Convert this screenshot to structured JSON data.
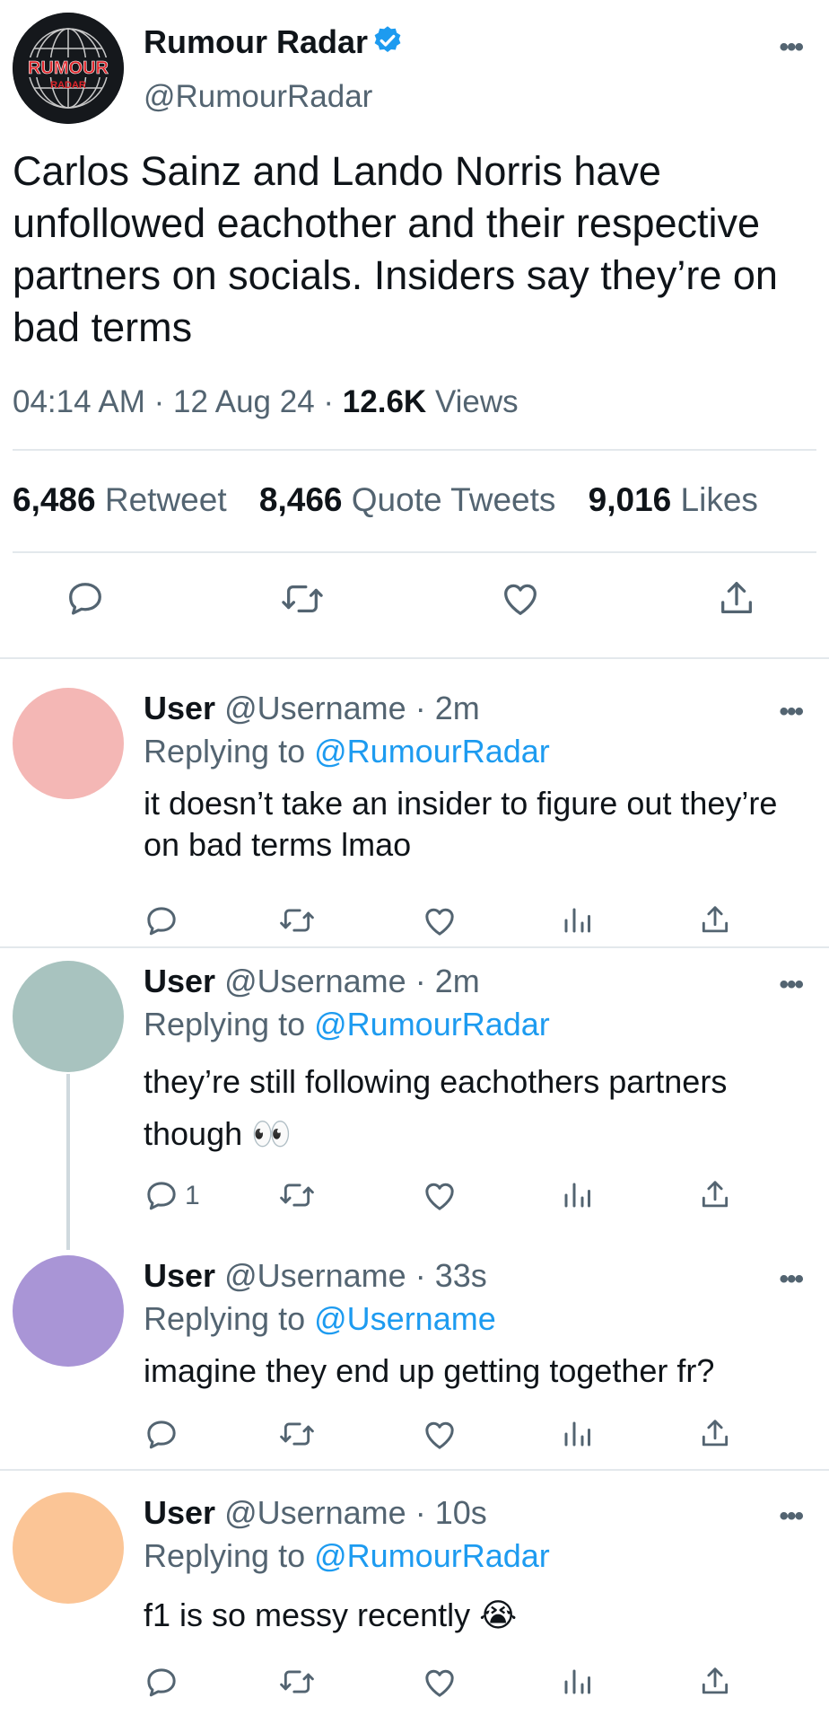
{
  "tweet": {
    "display_name": "Rumour Radar",
    "handle": "@RumourRadar",
    "logo_text_top": "RUMOUR",
    "logo_text_bottom": "RADAR",
    "text": "Carlos Sainz and Lando Norris have unfollowed eachother and their respective partners on socials. Insiders say they’re on bad terms",
    "time": "04:14 AM",
    "date": "12 Aug 24",
    "views_count": "12.6K",
    "views_label": "Views",
    "separator": "·",
    "retweets_count": "6,486",
    "retweets_label": "Retweet",
    "quotes_count": "8,466",
    "quotes_label": "Quote Tweets",
    "likes_count": "9,016",
    "likes_label": "Likes"
  },
  "more_glyph": "•••",
  "replies": [
    {
      "user": "User",
      "handle": "@Username",
      "time": "· 2m",
      "replying_prefix": "Replying to",
      "replying_to": "@RumourRadar",
      "text": "it doesn’t take an insider to figure out they’re on bad terms lmao",
      "avatar_color": "#f4b7b5",
      "reply_count": ""
    },
    {
      "user": "User",
      "handle": "@Username",
      "time": "· 2m",
      "replying_prefix": "Replying to",
      "replying_to": "@RumourRadar",
      "text": "they’re still following eachothers partners though 👀",
      "avatar_color": "#a8c3bf",
      "reply_count": "1"
    },
    {
      "user": "User",
      "handle": "@Username",
      "time": "· 33s",
      "replying_prefix": "Replying to",
      "replying_to": "@Username",
      "text": "imagine they end up getting together fr?",
      "avatar_color": "#a995d6",
      "reply_count": ""
    },
    {
      "user": "User",
      "handle": "@Username",
      "time": "· 10s",
      "replying_prefix": "Replying to",
      "replying_to": "@RumourRadar",
      "text": "f1 is so messy recently 😭",
      "avatar_color": "#fbc596",
      "reply_count": ""
    }
  ],
  "colors": {
    "link": "#1d9bf0",
    "secondary_text": "#536471",
    "divider": "#e3e8ec",
    "logo_red": "#e0262b"
  }
}
